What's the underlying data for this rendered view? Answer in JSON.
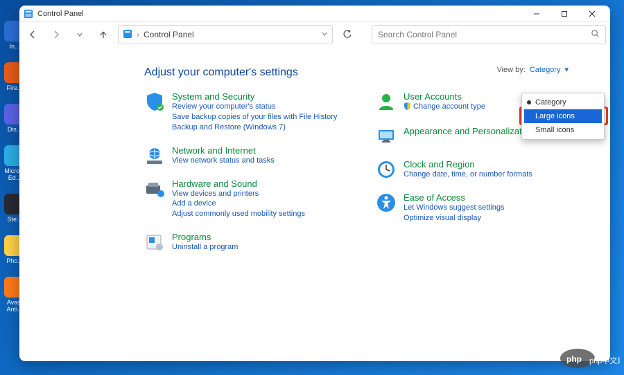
{
  "titlebar": {
    "title": "Control Panel"
  },
  "desktop_icons": [
    {
      "label": "In...",
      "color": "#2a6fd6"
    },
    {
      "label": "Fire...",
      "color": "#e85c1a"
    },
    {
      "label": "Dis...",
      "color": "#5a62e6"
    },
    {
      "label": "Micro...\nEd...",
      "color": "#2daee6"
    },
    {
      "label": "Ste...",
      "color": "#272a33"
    },
    {
      "label": "Pho...",
      "color": "#ffd14a"
    },
    {
      "label": "Avast\nAnti...",
      "color": "#ff7a1a"
    }
  ],
  "address": {
    "location": "Control Panel"
  },
  "search": {
    "placeholder": "Search Control Panel"
  },
  "heading": "Adjust your computer's settings",
  "viewby": {
    "label": "View by:",
    "value": "Category"
  },
  "dropdown": {
    "items": [
      {
        "label": "Category",
        "checked": true
      },
      {
        "label": "Large icons",
        "checked": false,
        "selected": true
      },
      {
        "label": "Small icons",
        "checked": false
      }
    ]
  },
  "left_col": [
    {
      "title": "System and Security",
      "links": [
        "Review your computer's status",
        "Save backup copies of your files with File History",
        "Backup and Restore (Windows 7)"
      ]
    },
    {
      "title": "Network and Internet",
      "links": [
        "View network status and tasks"
      ]
    },
    {
      "title": "Hardware and Sound",
      "links": [
        "View devices and printers",
        "Add a device",
        "Adjust commonly used mobility settings"
      ]
    },
    {
      "title": "Programs",
      "links": [
        "Uninstall a program"
      ]
    }
  ],
  "right_col": [
    {
      "title": "User Accounts",
      "links": [
        "Change account type"
      ],
      "shield": true
    },
    {
      "title": "Appearance and Personalization",
      "links": []
    },
    {
      "title": "Clock and Region",
      "links": [
        "Change date, time, or number formats"
      ]
    },
    {
      "title": "Ease of Access",
      "links": [
        "Let Windows suggest settings",
        "Optimize visual display"
      ]
    }
  ],
  "watermark": "php中文网"
}
